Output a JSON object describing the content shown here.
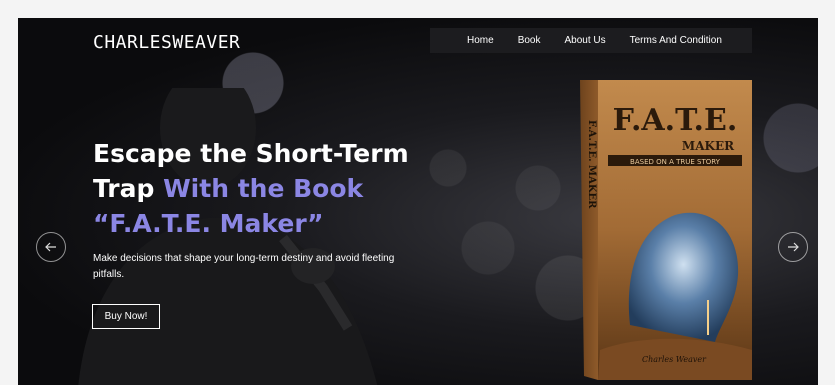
{
  "brand": {
    "logo": "CHARLESWEAVER"
  },
  "nav": {
    "items": [
      "Home",
      "Book",
      "About Us",
      "Terms And Condition"
    ]
  },
  "hero": {
    "title_line1": "Escape the Short-Term",
    "title_line2_plain": "Trap ",
    "title_line2_accent": "With the Book",
    "title_line3": "“F.A.T.E. Maker”",
    "subtitle": "Make decisions that shape your long-term destiny and avoid fleeting pitfalls.",
    "cta": "Buy Now!"
  },
  "book": {
    "title": "F.A.T.E.",
    "subtitle": "MAKER",
    "tagline": "BASED ON A TRUE STORY",
    "spine": "F.A.T.E. MAKER",
    "author_sig": "Charles Weaver"
  },
  "carousel": {
    "prev_icon": "arrow-left-icon",
    "next_icon": "arrow-right-icon"
  },
  "colors": {
    "accent": "#8b86e4",
    "background": "#0d0d0f",
    "book_brown": "#a26b35"
  }
}
